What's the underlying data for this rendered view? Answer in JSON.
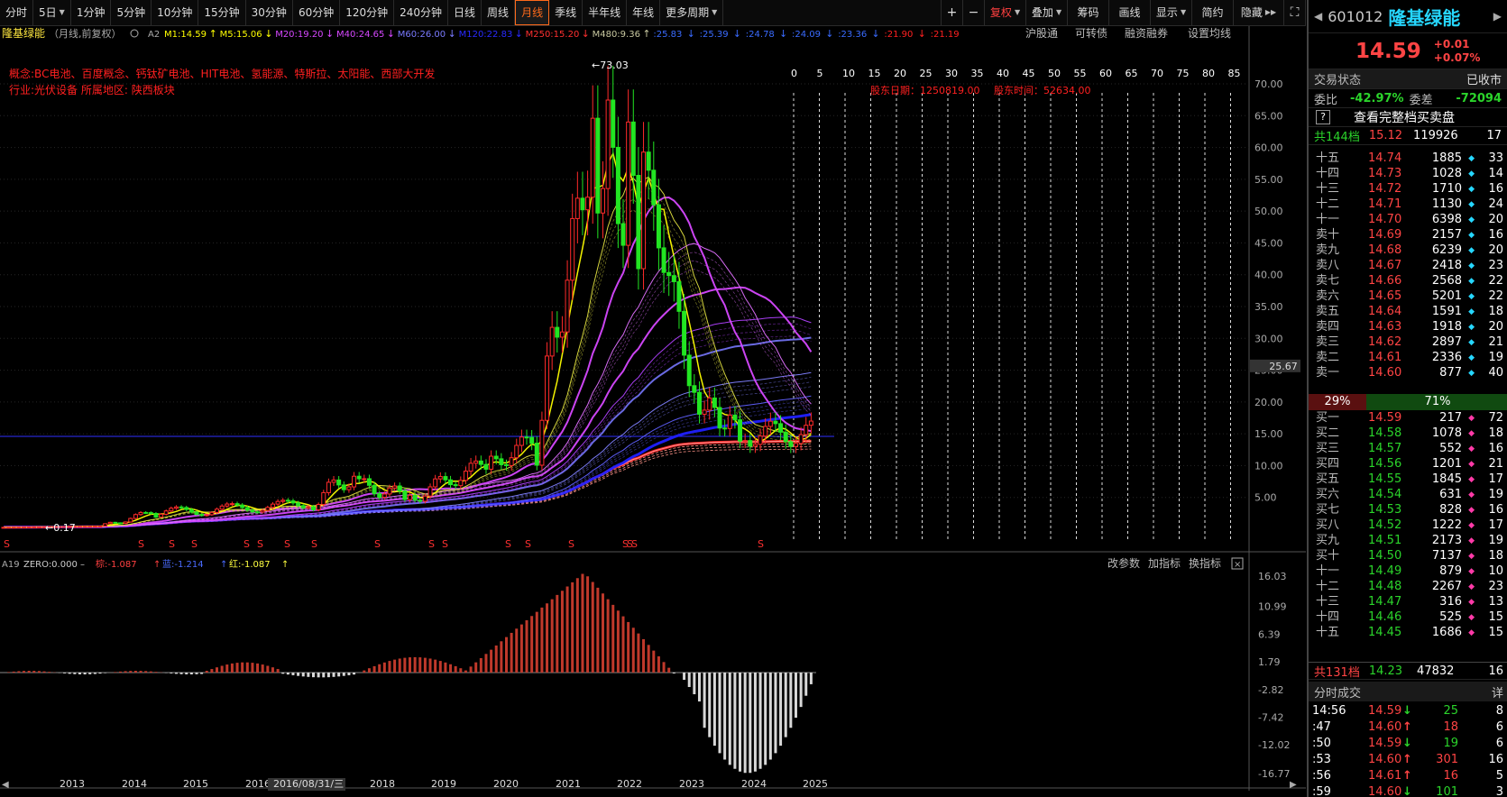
{
  "toolbar": {
    "periods": [
      "分时",
      "5日",
      "1分钟",
      "5分钟",
      "10分钟",
      "15分钟",
      "30分钟",
      "60分钟",
      "120分钟",
      "240分钟",
      "日线",
      "周线",
      "月线",
      "季线",
      "半年线",
      "年线",
      "更多周期"
    ],
    "active": "月线",
    "right_items": [
      "复权",
      "叠加",
      "筹码",
      "画线",
      "显示",
      "简约",
      "隐藏"
    ],
    "plus": "+",
    "minus": "−"
  },
  "stock": {
    "name": "隆基绿能",
    "code": "601012",
    "price": "14.59",
    "change": "+0.01",
    "change_pct": "+0.07%"
  },
  "main_chart": {
    "legend_prefix": "隆基绿能",
    "legend_mode": "（月线,前复权）",
    "legend_a2": "A2",
    "ma_items": [
      {
        "text": "M1:14.59",
        "color": "#ffff00",
        "arrow": "↑"
      },
      {
        "text": "M5:15.06",
        "color": "#ffff00",
        "arrow": "↓"
      },
      {
        "text": "M20:19.20",
        "color": "#d648ff",
        "arrow": "↓"
      },
      {
        "text": "M40:24.65",
        "color": "#d648ff",
        "arrow": "↓"
      },
      {
        "text": "M60:26.00",
        "color": "#7a7aff",
        "arrow": "↓"
      },
      {
        "text": "M120:22.83",
        "color": "#2a2aff",
        "arrow": "↓"
      },
      {
        "text": "M250:15.20",
        "color": "#ff3030",
        "arrow": "↓"
      },
      {
        "text": "M480:9.36",
        "color": "#c8c8a0",
        "arrow": "↑"
      }
    ],
    "ma_more": [
      {
        "text": ":25.83",
        "arrow": "↓"
      },
      {
        "text": ":25.39",
        "arrow": "↓"
      },
      {
        "text": ":24.78",
        "arrow": "↓"
      },
      {
        "text": ":24.09",
        "arrow": "↓"
      },
      {
        "text": ":23.36",
        "arrow": "↓"
      },
      {
        "text": ":21.90",
        "arrow": "↓"
      },
      {
        "text": ":21.19",
        "arrow": ""
      }
    ],
    "menu": [
      "沪股通",
      "可转债",
      "融资融券",
      "设置均线"
    ],
    "concept_line": "概念:BC电池、百度概念、钙钛矿电池、HIT电池、氢能源、特斯拉、太阳能、西部大开发",
    "industry_line": "行业:光伏设备    所属地区: 陕西板块",
    "shareholder_date": "股东日期：1250819.00",
    "shareholder_time": "股东时间：52634.00",
    "peak_label": "←73.03",
    "low_label": "←0.17",
    "current_price_tag": "25.67",
    "y_axis_ticks": [
      "70.00",
      "65.00",
      "60.00",
      "55.00",
      "50.00",
      "45.00",
      "40.00",
      "35.00",
      "30.00",
      "25.00",
      "20.00",
      "15.00",
      "10.00",
      "5.00"
    ],
    "gann_ticks": [
      "0",
      "5",
      "10",
      "15",
      "20",
      "25",
      "30",
      "35",
      "40",
      "45",
      "50",
      "55",
      "60",
      "65",
      "70",
      "75",
      "80",
      "85"
    ],
    "s_marker": "S"
  },
  "indicator": {
    "name": "A19",
    "zero": "ZERO:0.000 –",
    "brown": "棕:-1.087",
    "blue": "蓝:-1.214",
    "red": "红:-1.087",
    "menu": [
      "改参数",
      "加指标",
      "换指标"
    ],
    "y_axis_ticks": [
      "16.03",
      "10.99",
      "6.39",
      "1.79",
      "-2.82",
      "-7.42",
      "-12.02",
      "-16.77"
    ]
  },
  "x_axis": {
    "years": [
      "2013",
      "2014",
      "2015",
      "2016",
      "2016/08/31/三",
      "2018",
      "2019",
      "2020",
      "2021",
      "2022",
      "2023",
      "2024",
      "2025"
    ]
  },
  "quote_panel": {
    "status_label": "交易状态",
    "status_value": "已收市",
    "wb_label": "委比",
    "wb_value": "-42.97%",
    "wc_label": "委差",
    "wc_value": "-72094",
    "full_book_link": "查看完整档买卖盘",
    "ask_total": {
      "label": "共144档",
      "price": "15.12",
      "volume": "119926",
      "count": "17"
    },
    "asks": [
      {
        "label": "十五",
        "price": "14.74",
        "volume": "1885",
        "count": "33"
      },
      {
        "label": "十四",
        "price": "14.73",
        "volume": "1028",
        "count": "14"
      },
      {
        "label": "十三",
        "price": "14.72",
        "volume": "1710",
        "count": "16"
      },
      {
        "label": "十二",
        "price": "14.71",
        "volume": "1130",
        "count": "24"
      },
      {
        "label": "十一",
        "price": "14.70",
        "volume": "6398",
        "count": "20"
      },
      {
        "label": "卖十",
        "price": "14.69",
        "volume": "2157",
        "count": "16"
      },
      {
        "label": "卖九",
        "price": "14.68",
        "volume": "6239",
        "count": "20"
      },
      {
        "label": "卖八",
        "price": "14.67",
        "volume": "2418",
        "count": "23"
      },
      {
        "label": "卖七",
        "price": "14.66",
        "volume": "2568",
        "count": "22"
      },
      {
        "label": "卖六",
        "price": "14.65",
        "volume": "5201",
        "count": "22"
      },
      {
        "label": "卖五",
        "price": "14.64",
        "volume": "1591",
        "count": "18"
      },
      {
        "label": "卖四",
        "price": "14.63",
        "volume": "1918",
        "count": "20"
      },
      {
        "label": "卖三",
        "price": "14.62",
        "volume": "2897",
        "count": "21"
      },
      {
        "label": "卖二",
        "price": "14.61",
        "volume": "2336",
        "count": "19"
      },
      {
        "label": "卖一",
        "price": "14.60",
        "volume": "877",
        "count": "40"
      }
    ],
    "ratio_sell": "29%",
    "ratio_buy": "71%",
    "bids": [
      {
        "label": "买一",
        "price": "14.59",
        "volume": "217",
        "count": "72"
      },
      {
        "label": "买二",
        "price": "14.58",
        "volume": "1078",
        "count": "18"
      },
      {
        "label": "买三",
        "price": "14.57",
        "volume": "552",
        "count": "16"
      },
      {
        "label": "买四",
        "price": "14.56",
        "volume": "1201",
        "count": "21"
      },
      {
        "label": "买五",
        "price": "14.55",
        "volume": "1845",
        "count": "17"
      },
      {
        "label": "买六",
        "price": "14.54",
        "volume": "631",
        "count": "19"
      },
      {
        "label": "买七",
        "price": "14.53",
        "volume": "828",
        "count": "16"
      },
      {
        "label": "买八",
        "price": "14.52",
        "volume": "1222",
        "count": "17"
      },
      {
        "label": "买九",
        "price": "14.51",
        "volume": "2173",
        "count": "19"
      },
      {
        "label": "买十",
        "price": "14.50",
        "volume": "7137",
        "count": "18"
      },
      {
        "label": "十一",
        "price": "14.49",
        "volume": "879",
        "count": "10"
      },
      {
        "label": "十二",
        "price": "14.48",
        "volume": "2267",
        "count": "23"
      },
      {
        "label": "十三",
        "price": "14.47",
        "volume": "316",
        "count": "13"
      },
      {
        "label": "十四",
        "price": "14.46",
        "volume": "525",
        "count": "15"
      },
      {
        "label": "十五",
        "price": "14.45",
        "volume": "1686",
        "count": "15"
      }
    ],
    "bid_total": {
      "label": "共131档",
      "price": "14.23",
      "volume": "47832",
      "count": "16"
    },
    "trades_title": "分时成交",
    "trades_detail": "详",
    "trades": [
      {
        "time": "14:56",
        "price": "14.59",
        "dir": "↓",
        "vol": "25",
        "n": "8"
      },
      {
        "time": ":47",
        "price": "14.60",
        "dir": "↑",
        "vol": "18",
        "n": "6"
      },
      {
        "time": ":50",
        "price": "14.59",
        "dir": "↓",
        "vol": "19",
        "n": "6"
      },
      {
        "time": ":53",
        "price": "14.60",
        "dir": "↑",
        "vol": "301",
        "n": "16"
      },
      {
        "time": ":56",
        "price": "14.61",
        "dir": "↑",
        "vol": "16",
        "n": "5"
      },
      {
        "time": ":59",
        "price": "14.60",
        "dir": "↓",
        "vol": "101",
        "n": "3"
      }
    ]
  }
}
